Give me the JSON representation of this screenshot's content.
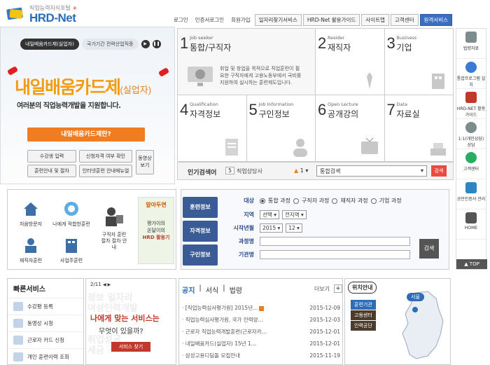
{
  "header": {
    "logo_sub": "직업능력지식포털",
    "logo_name": "HRD-Net",
    "nav_links": [
      "로그인",
      "인증서로그인",
      "회원가입"
    ],
    "nav_boxes": [
      "일자리찾기서비스",
      "HRD-Net 활용가이드",
      "사이트맵",
      "고객센터",
      "원격서비스"
    ]
  },
  "hero": {
    "tab_active": "내일배움카드제(실업자)",
    "tab_other": "국가기간 전략산업직종",
    "title_main": "내일배움카드제",
    "title_suffix": "(실업자)",
    "description": "여러분의 직업능력개발을 지원합니다.",
    "cta": "내일배움카드제란?",
    "buttons": [
      "수강생 입력",
      "신청자격 여부 확인",
      "훈련안내 및 절차",
      "인터넷훈련 안내매뉴얼"
    ],
    "video_btn": [
      "동영상",
      "보기"
    ]
  },
  "grid": [
    {
      "num": "1",
      "en": "Job seeker",
      "ko": "통합/구직자",
      "desc": "취업 및 창업을 목적으로 직업훈련이 필요한 구직자에게 고용노동부에서 국비를 지원하여 실시하는 훈련제도입니다."
    },
    {
      "num": "2",
      "en": "Resider",
      "ko": "재직자"
    },
    {
      "num": "3",
      "en": "Business",
      "ko": "기업"
    },
    {
      "num": "4",
      "en": "Qualification",
      "ko": "자격정보"
    },
    {
      "num": "5",
      "en": "Job Information",
      "ko": "구인정보"
    },
    {
      "num": "6",
      "en": "Open Lecture",
      "ko": "공개강의"
    },
    {
      "num": "7",
      "en": "Data",
      "ko": "자료실"
    }
  ],
  "search_row": {
    "title": "인기검색어",
    "rank": "5",
    "word": "직업상담사",
    "arrow": "1",
    "select": "통합검색",
    "button": "검색"
  },
  "sidebar": [
    "법령자료",
    "통합프로그램 설치",
    "HRD-NET 활용가이드",
    "1:1(개인상담) 상담",
    "고객센터",
    "공인인증서 관리",
    "HOME"
  ],
  "sidebar_top": "▲ TOP",
  "mid_left": {
    "items": [
      "처음방문자",
      "나에게 적합한훈련",
      "구직자 훈련절차 절차 안내",
      "재직자훈련",
      "사업주훈련"
    ],
    "promo_lines": [
      "알아두면",
      "평가이의",
      "온달이의",
      "HRD 활용기"
    ]
  },
  "search_panel": {
    "tabs": [
      "훈련정보",
      "자격정보",
      "구인정보"
    ],
    "target_label": "대상",
    "radios": [
      "통합 과정",
      "구직자 과정",
      "재직자 과정",
      "기업 과정"
    ],
    "region_label": "지역",
    "region_sel": [
      "선택",
      "전지역"
    ],
    "date_label": "시작년월",
    "year": "2015",
    "month": "12",
    "course_label": "과정명",
    "org_label": "기관명",
    "button": "검색"
  },
  "quick": {
    "title": "빠른서비스",
    "items": [
      "수강평 등록",
      "동영상 시청",
      "근로자 카드 신청",
      "개인 훈련이력 조회"
    ]
  },
  "ad": {
    "page": "2/11",
    "bg_words": [
      "정보 일자리",
      "여성인력개발",
      "취업성공",
      "세금"
    ],
    "title": "나에게 맞는 서비스는",
    "sub": "무엇이 있을까?",
    "button": "서비스 찾기"
  },
  "notices": {
    "tabs": [
      "공지",
      "서식",
      "법령"
    ],
    "more": "더보기",
    "rows": [
      {
        "title": "[직업능력심사평가원] 2015년...",
        "date": "2015-12-09",
        "new": true
      },
      {
        "title": "직업능력심사평가원, 국가 인력양...",
        "date": "2015-12-03",
        "new": false
      },
      {
        "title": "근로자 직업능력개발훈련(근로자카...",
        "date": "2015-12-01",
        "new": false
      },
      {
        "title": "내일배움카드(실업자) 15년 1...",
        "date": "2015-12-01",
        "new": false
      },
      {
        "title": "삼성고용디딤돌 모집안내",
        "date": "2015-11-19",
        "new": false
      }
    ]
  },
  "location": {
    "title": "위치안내",
    "buttons": [
      "훈련기관",
      "고용센터",
      "인력공단"
    ],
    "region": "서울"
  }
}
